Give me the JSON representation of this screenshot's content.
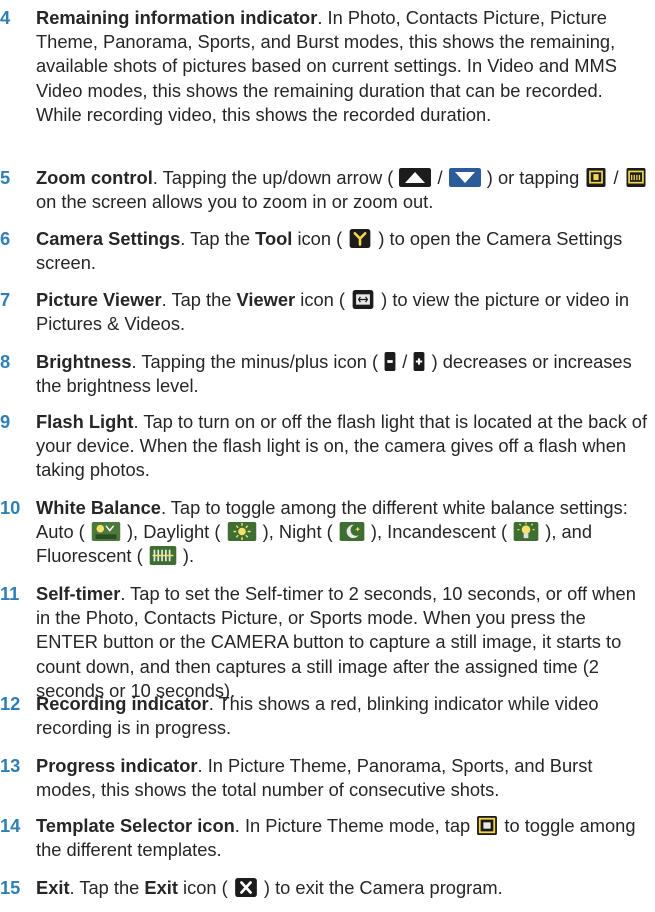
{
  "items": [
    {
      "num": "4",
      "title": "Remaining information indicator",
      "rest": ". In Photo, Contacts Picture, Picture Theme, Panorama, Sports, and Burst modes, this shows the remaining, available shots of pictures based on current settings. In Video and MMS Video modes, this shows the remaining duration that can be recorded. While recording video, this shows the recorded duration."
    },
    {
      "num": "5",
      "title": "Zoom control",
      "p1": ". Tapping the up/down arrow (",
      "p2": "/",
      "p3": ") or tapping",
      "p4": "/",
      "p5": "on the screen allows you to zoom in or zoom out."
    },
    {
      "num": "6",
      "title": "Camera Settings",
      "p1": ". Tap the ",
      "b1": "Tool",
      "p2": " icon (",
      "p3": ") to open the Camera Settings screen."
    },
    {
      "num": "7",
      "title": "Picture Viewer",
      "p1": ". Tap the ",
      "b1": "Viewer",
      "p2": " icon (",
      "p3": ") to view the picture or video in Pictures & Videos."
    },
    {
      "num": "8",
      "title": "Brightness",
      "p1": ". Tapping the minus/plus icon (",
      "p2": "/",
      "p3": ") decreases or increases the brightness level."
    },
    {
      "num": "9",
      "title": "Flash Light",
      "rest": ". Tap to turn on or off the flash light that is located at the back of your device. When the flash light is on, the camera gives off a flash when taking photos."
    },
    {
      "num": "10",
      "title": "White Balance",
      "p1": ". Tap to toggle among the different white balance settings: Auto (",
      "p2": "), Daylight (",
      "p3": "), Night (",
      "p4": "), Incandescent (",
      "p5": "), and Fluorescent (",
      "p6": ")."
    },
    {
      "num": "11",
      "title": "Self-timer",
      "rest": ". Tap to set the Self-timer to 2 seconds, 10 seconds, or off when in the Photo, Contacts Picture, or Sports mode. When you press the ENTER button or the CAMERA button to capture a still image, it starts to count down, and then captures a still image after the assigned time (2 seconds or 10 seconds)."
    },
    {
      "num": "12",
      "title": "Recording indicator",
      "rest": ". This shows a red, blinking indicator while video recording is in progress."
    },
    {
      "num": "13",
      "title": "Progress indicator",
      "rest": ". In Picture Theme, Panorama, Sports, and Burst modes, this shows the total number of consecutive shots."
    },
    {
      "num": "14",
      "title": "Template Selector icon",
      "p1": ". In Picture Theme mode, tap",
      "p2": "to toggle among the different templates."
    },
    {
      "num": "15",
      "title": "Exit",
      "p1": ". Tap the ",
      "b1": "Exit",
      "p2": " icon (",
      "p3": ") to exit the Camera program."
    }
  ],
  "icons": {
    "zoom_up": "up-arrow-icon",
    "zoom_down": "down-arrow-icon",
    "zoom_in": "zoom-in-icon",
    "zoom_out": "zoom-out-icon",
    "tool": "tool-icon",
    "viewer": "viewer-icon",
    "minus": "minus-icon",
    "plus": "plus-icon",
    "wb_auto": "auto-wb-icon",
    "wb_daylight": "daylight-icon",
    "wb_night": "night-icon",
    "wb_incandescent": "incandescent-icon",
    "wb_fluorescent": "fluorescent-icon",
    "template": "template-icon",
    "exit": "exit-icon"
  },
  "colors": {
    "number": "#2f7fb5",
    "text": "#262626",
    "icon_dark": "#1c1c1c"
  }
}
